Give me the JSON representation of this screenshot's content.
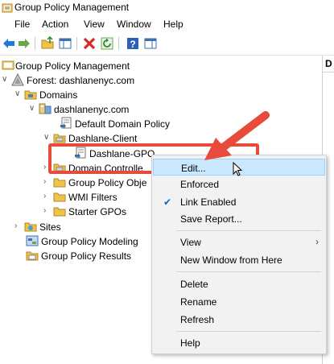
{
  "window": {
    "title": "Group Policy Management"
  },
  "menu": [
    "File",
    "Action",
    "View",
    "Window",
    "Help"
  ],
  "tree": {
    "root": "Group Policy Management",
    "forest": "Forest: dashlanenyc.com",
    "domains": "Domains",
    "domain": "dashlanenyc.com",
    "default_policy": "Default Domain Policy",
    "ou_dashlane": "Dashlane-Client",
    "gpo_link": "Dashlane-GPO",
    "domain_controllers": "Domain Controlle",
    "gpo_objects": "Group Policy Obje",
    "wmi": "WMI Filters",
    "starter": "Starter GPOs",
    "sites": "Sites",
    "modeling": "Group Policy Modeling",
    "results": "Group Policy Results"
  },
  "right_pane_header": "D",
  "context_menu": {
    "edit": "Edit...",
    "enforced": "Enforced",
    "link_enabled": "Link Enabled",
    "save_report": "Save Report...",
    "view": "View",
    "new_window": "New Window from Here",
    "delete": "Delete",
    "rename": "Rename",
    "refresh": "Refresh",
    "help": "Help"
  },
  "colors": {
    "highlight_box": "#e84b3c",
    "menu_hover": "#cce8ff"
  }
}
